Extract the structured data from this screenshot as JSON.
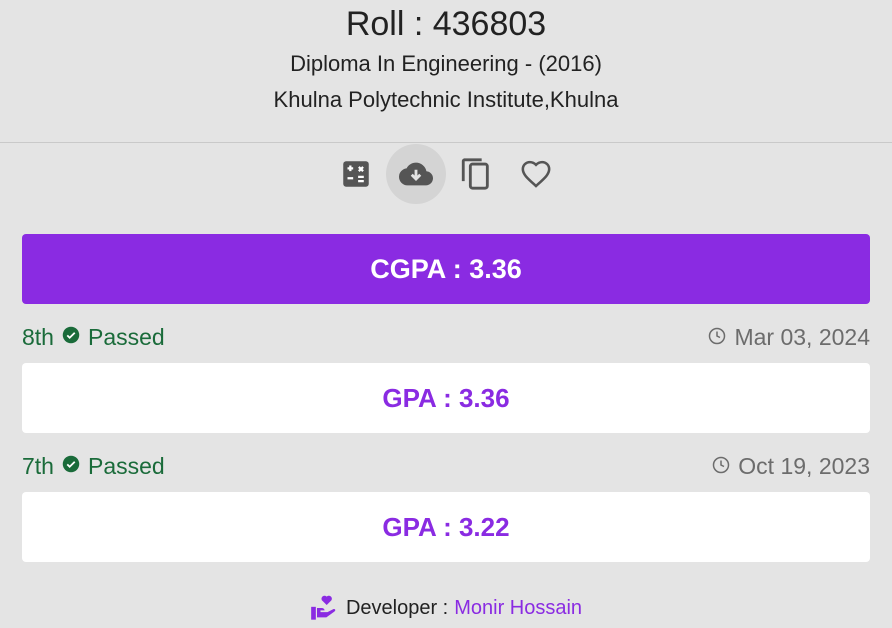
{
  "header": {
    "roll": "Roll : 436803",
    "exam": "Diploma In Engineering - (2016)",
    "institute": "Khulna Polytechnic Institute,Khulna"
  },
  "toolbar": {
    "items": [
      {
        "icon": "calculator-icon"
      },
      {
        "icon": "cloud-download-icon"
      },
      {
        "icon": "copy-icon"
      },
      {
        "icon": "heart-icon"
      }
    ]
  },
  "summary": {
    "cgpa": "CGPA : 3.36"
  },
  "semesters": [
    {
      "semester": "8th",
      "status": "Passed",
      "date": "Mar 03, 2024",
      "gpa": "GPA : 3.36"
    },
    {
      "semester": "7th",
      "status": "Passed",
      "date": "Oct 19, 2023",
      "gpa": "GPA : 3.22"
    }
  ],
  "footer": {
    "label": "Developer :",
    "name": "Monir Hossain"
  },
  "colors": {
    "accent": "#8a2be2",
    "passed": "#1a6b3a",
    "background": "#e4e4e4"
  }
}
